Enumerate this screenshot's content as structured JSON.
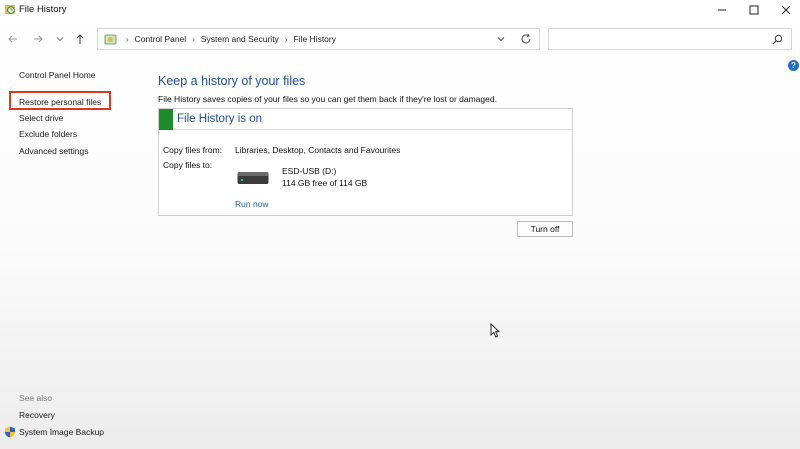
{
  "window": {
    "title": "File History",
    "app_icon": "file-history-icon"
  },
  "titlebar_buttons": {
    "minimize": "—",
    "maximize": "☐",
    "close": "✕"
  },
  "nav": {
    "back_icon": "back-arrow-icon",
    "forward_icon": "forward-arrow-icon",
    "recent_icon": "chevron-down-icon",
    "up_icon": "up-arrow-icon"
  },
  "address": {
    "crumbs": [
      "Control Panel",
      "System and Security",
      "File History"
    ]
  },
  "search": {
    "placeholder": ""
  },
  "sidebar": {
    "items": [
      {
        "label": "Control Panel Home"
      },
      {
        "label": "Restore personal files"
      },
      {
        "label": "Select drive"
      },
      {
        "label": "Exclude folders"
      },
      {
        "label": "Advanced settings"
      }
    ],
    "see_also_label": "See also",
    "see_also": [
      {
        "label": "Recovery"
      },
      {
        "label": "System Image Backup"
      }
    ]
  },
  "main": {
    "heading": "Keep a history of your files",
    "description": "File History saves copies of your files so you can get them back if they're lost or damaged.",
    "status_title": "File History is on",
    "copy_from_label": "Copy files from:",
    "copy_from_value": "Libraries, Desktop, Contacts and Favourites",
    "copy_to_label": "Copy files to:",
    "drive_name": "ESD-USB (D:)",
    "drive_free": "114 GB free of 114 GB",
    "run_now": "Run now",
    "turn_off": "Turn off"
  },
  "colors": {
    "heading_blue": "#1f4f9a",
    "status_green": "#1f8a2c",
    "highlight_red": "#d93a1d",
    "link_blue": "#1f5fb0"
  }
}
